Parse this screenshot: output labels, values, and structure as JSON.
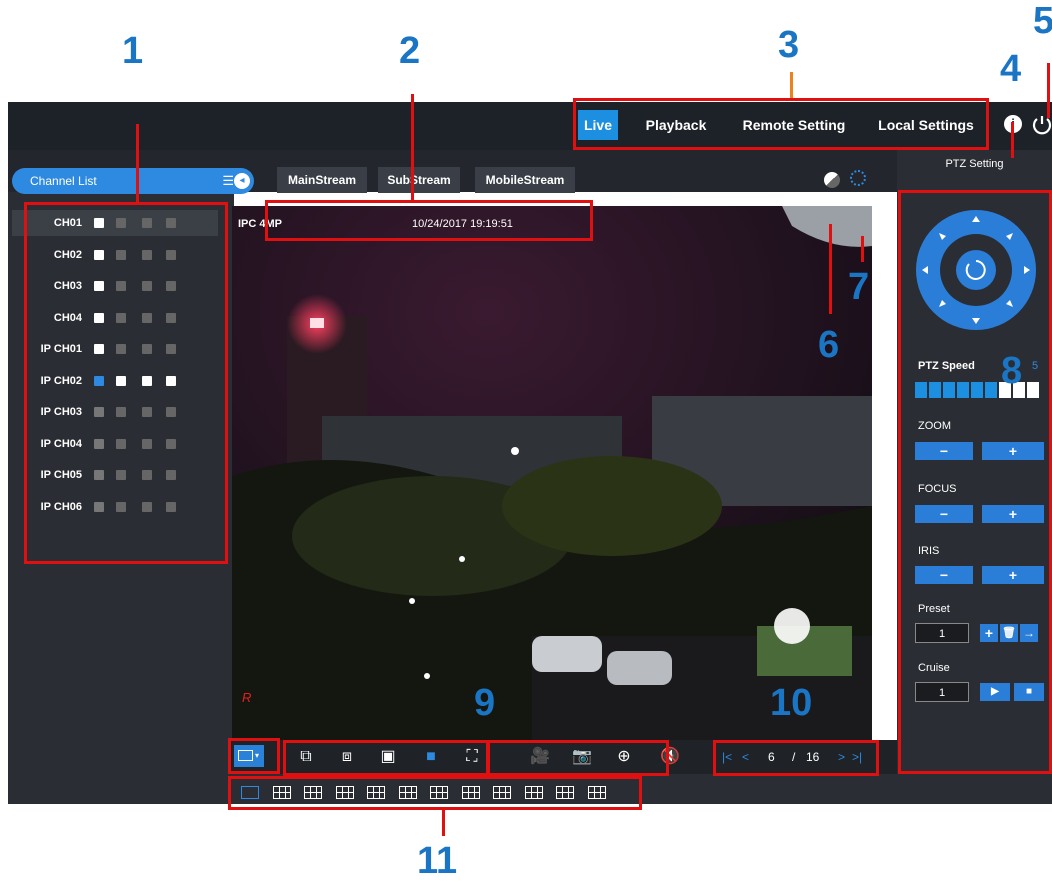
{
  "callouts": [
    "1",
    "2",
    "3",
    "4",
    "5",
    "6",
    "7",
    "8",
    "9",
    "10",
    "11"
  ],
  "nav": {
    "live": "Live",
    "playback": "Playback",
    "remote_setting": "Remote Setting",
    "local_settings": "Local Settings"
  },
  "channel_list": {
    "title": "Channel List",
    "channels": [
      "CH01",
      "CH02",
      "CH03",
      "CH04",
      "IP CH01",
      "IP CH02",
      "IP CH03",
      "IP CH04",
      "IP CH05",
      "IP CH06"
    ]
  },
  "streams": [
    "MainStream",
    "SubStream",
    "MobileStream"
  ],
  "video": {
    "camera_label": "IPC 4MP",
    "timestamp": "10/24/2017 19:19:51",
    "rec_indicator": "R"
  },
  "ptz": {
    "title": "PTZ Setting",
    "speed_label": "PTZ Speed",
    "speed_value": "5",
    "speed_level": 0.625,
    "zoom_label": "ZOOM",
    "focus_label": "FOCUS",
    "iris_label": "IRIS",
    "minus": "−",
    "plus": "+",
    "preset_label": "Preset",
    "preset_value": "1",
    "cruise_label": "Cruise",
    "cruise_value": "1"
  },
  "pager": {
    "current": "6",
    "separator": "/",
    "total": "16"
  },
  "colors": {
    "accent": "#1c8fe0",
    "callout": "#1a76c4",
    "highlight": "#e01010"
  }
}
